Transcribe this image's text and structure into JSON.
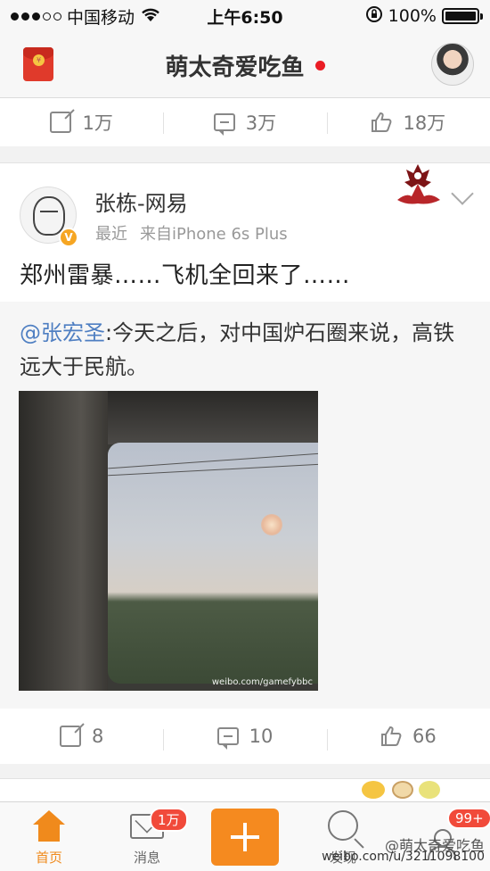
{
  "status_bar": {
    "carrier": "中国移动",
    "time": "上午6:50",
    "battery": "100%"
  },
  "nav": {
    "title": "萌太奇爱吃鱼"
  },
  "prev_post_actions": {
    "repost": "1万",
    "comment": "3万",
    "like": "18万"
  },
  "post": {
    "author": "张栋-网易",
    "time": "最近",
    "source": "来自iPhone 6s Plus",
    "text": "郑州雷暴……飞机全回来了……",
    "retweet": {
      "mention": "@张宏圣",
      "text": ":今天之后，对中国炉石圈来说，高铁远大于民航。",
      "image_watermark": "weibo.com/gamefybbc"
    },
    "actions": {
      "repost": "8",
      "comment": "10",
      "like": "66"
    }
  },
  "tab_bar": {
    "home": "首页",
    "messages": "消息",
    "messages_badge": "1万",
    "discover": "发现",
    "me_badge": "99+"
  },
  "watermark": {
    "line1": "@萌太奇爱吃鱼",
    "line2": "weibo.com/u/3211098100"
  },
  "colors": {
    "accent": "#f08a1c",
    "link": "#4f7fc2",
    "badge": "#f14a3a"
  }
}
